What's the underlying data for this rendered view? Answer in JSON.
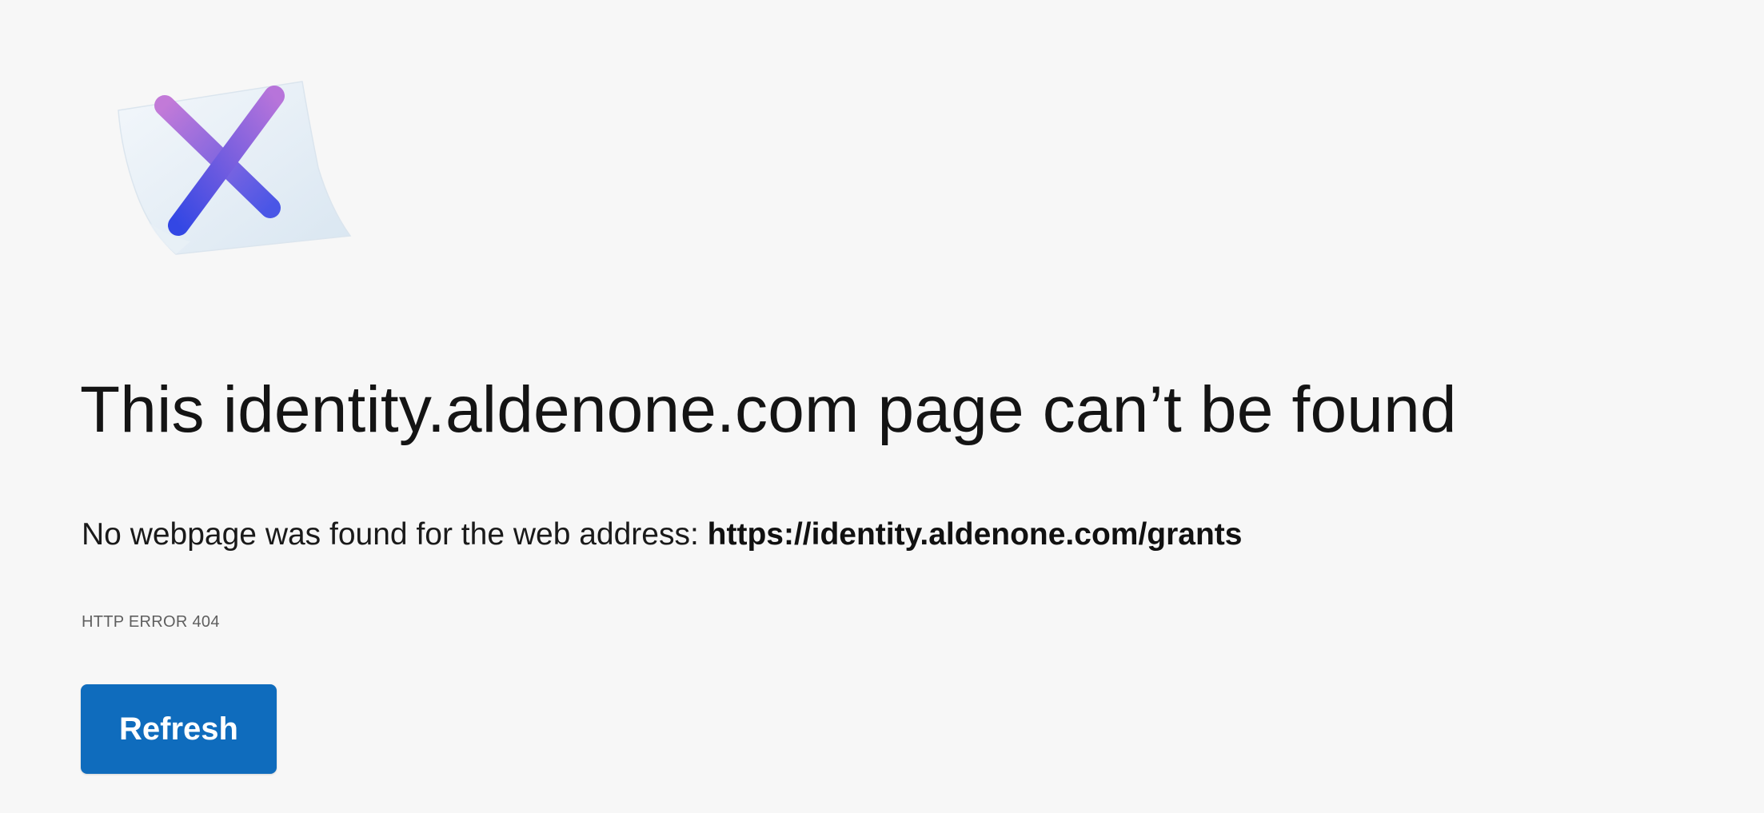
{
  "page": {
    "illustration": "error-x-note-icon",
    "title": "This identity.aldenone.com page can’t be found",
    "message_prefix": "No webpage was found for the web address: ",
    "message_url": "https://identity.aldenone.com/grants",
    "error_code": "HTTP ERROR 404",
    "refresh_label": "Refresh"
  },
  "colors": {
    "background": "#f7f7f7",
    "button": "#0f6cbd",
    "icon_x_purple": "#b06ad6",
    "icon_x_blue": "#3b4fe0"
  }
}
